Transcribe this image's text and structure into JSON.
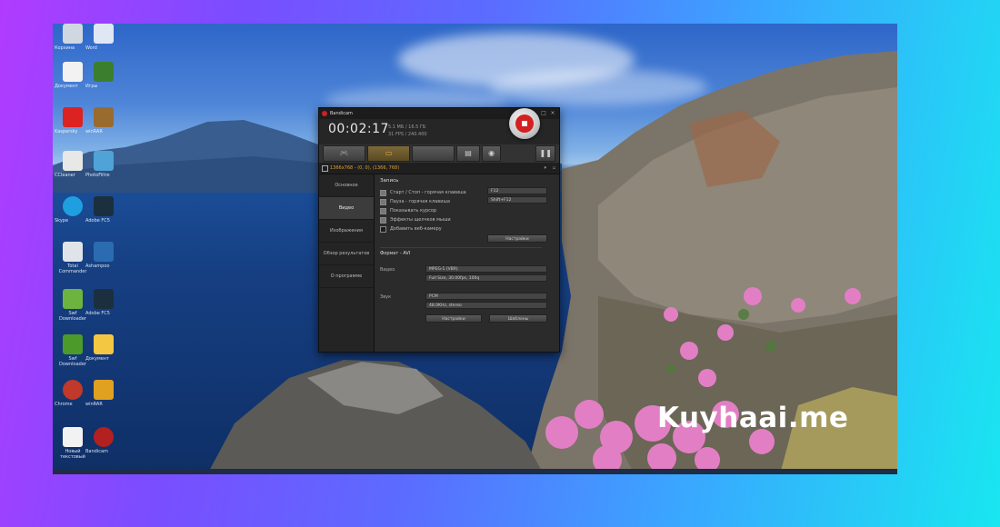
{
  "watermark": "Kuyhaai.me",
  "bandicam": {
    "title": "Bandicam",
    "timer": "00:02:17",
    "size_info": [
      "5.1 МБ / 16.5 ГБ",
      "31 FPS / 240.400"
    ],
    "recording_target": "1366x768 - (0, 0), (1366, 768)",
    "tabs": [
      "game-tab",
      "screen-tab",
      "device-tab",
      "folder-tab",
      "camera-tab"
    ],
    "sidebar": [
      "Основное",
      "Видео",
      "Изображения",
      "Обзор результатов",
      "О программе"
    ],
    "selected_sidebar": "Видео",
    "record_section": {
      "title": "Запись",
      "options": [
        {
          "label": "Старт / Стоп - горячая клавиша",
          "checked": true,
          "value": "F12"
        },
        {
          "label": "Пауза - горячая клавиша",
          "checked": true,
          "value": "Shift+F12"
        },
        {
          "label": "Показывать курсор",
          "checked": true,
          "value": ""
        },
        {
          "label": "Эффекты щелчков мыши",
          "checked": true,
          "value": ""
        },
        {
          "label": "Добавить веб-камеру",
          "checked": false,
          "value": ""
        }
      ],
      "settings_button": "Настройки"
    },
    "format_section": {
      "title": "Формат - AVI",
      "video_label": "Видео",
      "video_values": [
        "MPEG-1 (VBR)",
        "Full Size, 30.00fps, 100q"
      ],
      "audio_label": "Звук",
      "audio_values": [
        "PCM",
        "48.0KHz, stereo"
      ],
      "settings_button": "Настройки",
      "templates_button": "Шаблоны"
    }
  },
  "desktop_icons": [
    "Корзина",
    "Word",
    "Документ",
    "Игры",
    "Kaspersky",
    "winRAR",
    "CCleaner",
    "Skype",
    "PhotoFiltre",
    "Total Commander",
    "Swf Downloader",
    "Ashampoo",
    "Chrome",
    "Bandicam",
    "Новый текстовый",
    "Adobe FC5"
  ]
}
